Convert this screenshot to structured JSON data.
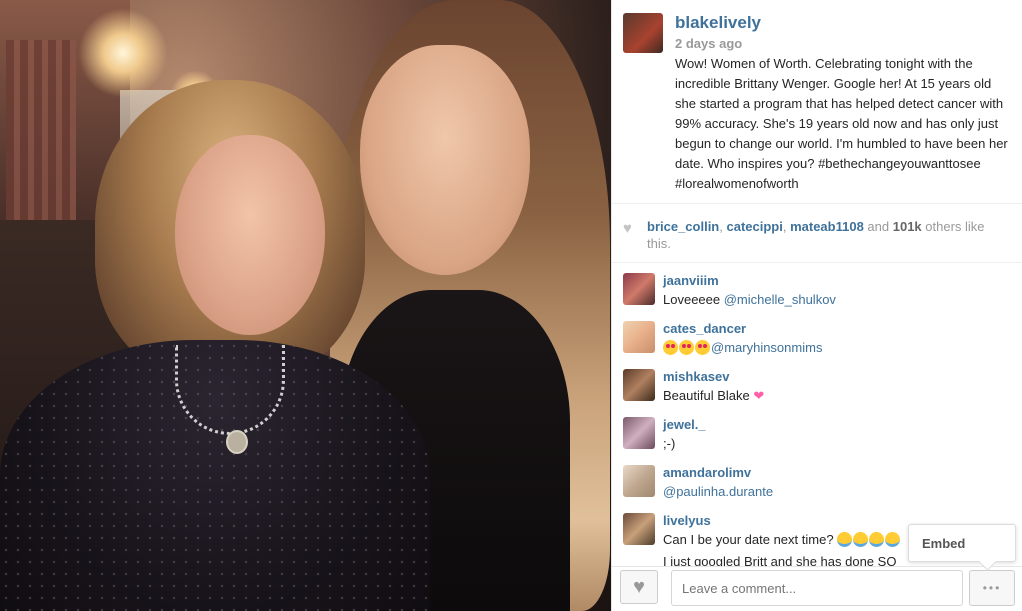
{
  "post": {
    "username": "blakelively",
    "timestamp": "2 days ago",
    "caption": "Wow! Women of Worth. Celebrating tonight with the incredible Brittany Wenger. Google her! At 15 years old she started a program that has helped detect cancer with 99% accuracy. She's 19 years old now and has only just begun to change our world. I'm humbled to have been her date. Who inspires you? #bethechangeyouwanttosee #lorealwomenofworth"
  },
  "likes": {
    "user1": "brice_collin",
    "sep1": ", ",
    "user2": "catecippi",
    "sep2": ", ",
    "user3": "mateab1108",
    "and": " and ",
    "count": "101k",
    "suffix": " others like this."
  },
  "comments": [
    {
      "username": "jaanviiim",
      "prefix": "Loveeeee ",
      "mention": "@michelle_shulkov"
    },
    {
      "username": "cates_dancer",
      "prefix": "",
      "mention": "@maryhinsonmims"
    },
    {
      "username": "mishkasev",
      "text": "Beautiful Blake "
    },
    {
      "username": "jewel._",
      "text": ";-)"
    },
    {
      "username": "amandarolimv",
      "prefix": "",
      "mention": "@paulinha.durante"
    },
    {
      "username": "livelyus",
      "text": "Can I be your date next time? "
    },
    {
      "username": "",
      "text": "I just googled Britt and she has done SO"
    }
  ],
  "footer": {
    "comment_placeholder": "Leave a comment...",
    "more_label": "•••",
    "like_icon": "heart-icon"
  },
  "popover": {
    "embed_label": "Embed"
  },
  "colors": {
    "username": "#3f729b",
    "timestamp": "#999999"
  }
}
